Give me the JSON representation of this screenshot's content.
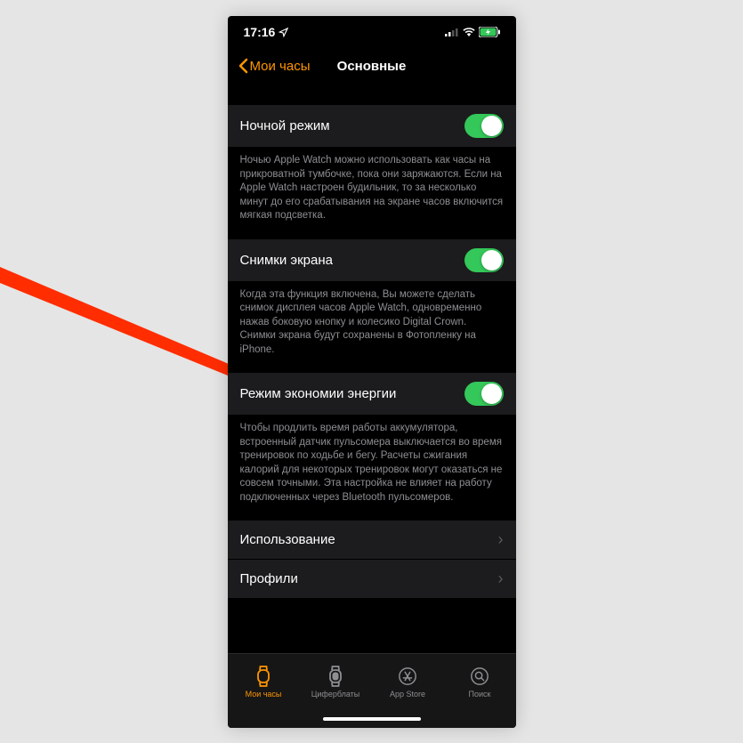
{
  "status_bar": {
    "time": "17:16"
  },
  "nav": {
    "back_label": "Мои часы",
    "title": "Основные"
  },
  "settings": [
    {
      "key": "night_mode",
      "label": "Ночной режим",
      "type": "toggle",
      "value": true,
      "footer": "Ночью Apple Watch можно использовать как часы на прикроватной тумбочке, пока они заряжаются. Если на Apple Watch настроен будильник, то за несколько минут до его срабатывания на экране часов включится мягкая подсветка."
    },
    {
      "key": "screenshots",
      "label": "Снимки экрана",
      "type": "toggle",
      "value": true,
      "footer": "Когда эта функция включена, Вы можете сделать снимок дисплея часов Apple Watch, одновременно нажав боковую кнопку и колесико Digital Crown. Снимки экрана будут сохранены в Фотопленку на iPhone."
    },
    {
      "key": "power_saving",
      "label": "Режим экономии энергии",
      "type": "toggle",
      "value": true,
      "footer": "Чтобы продлить время работы аккумулятора, встроенный датчик пульсомера выключается во время тренировок по ходьбе и бегу. Расчеты сжигания калорий для некоторых тренировок могут оказаться не совсем точными. Эта настройка не влияет на работу подключенных через Bluetooth пульсомеров."
    },
    {
      "key": "usage",
      "label": "Использование",
      "type": "nav"
    },
    {
      "key": "profiles",
      "label": "Профили",
      "type": "nav"
    }
  ],
  "tabs": [
    {
      "key": "my_watch",
      "label": "Мои часы",
      "active": true
    },
    {
      "key": "faces",
      "label": "Циферблаты",
      "active": false
    },
    {
      "key": "app_store",
      "label": "App Store",
      "active": false
    },
    {
      "key": "search",
      "label": "Поиск",
      "active": false
    }
  ],
  "colors": {
    "accent": "#ff9500",
    "toggle_on": "#34c759",
    "background": "#000000",
    "cell_bg": "#1c1c1e",
    "secondary_text": "#8e8e93"
  }
}
